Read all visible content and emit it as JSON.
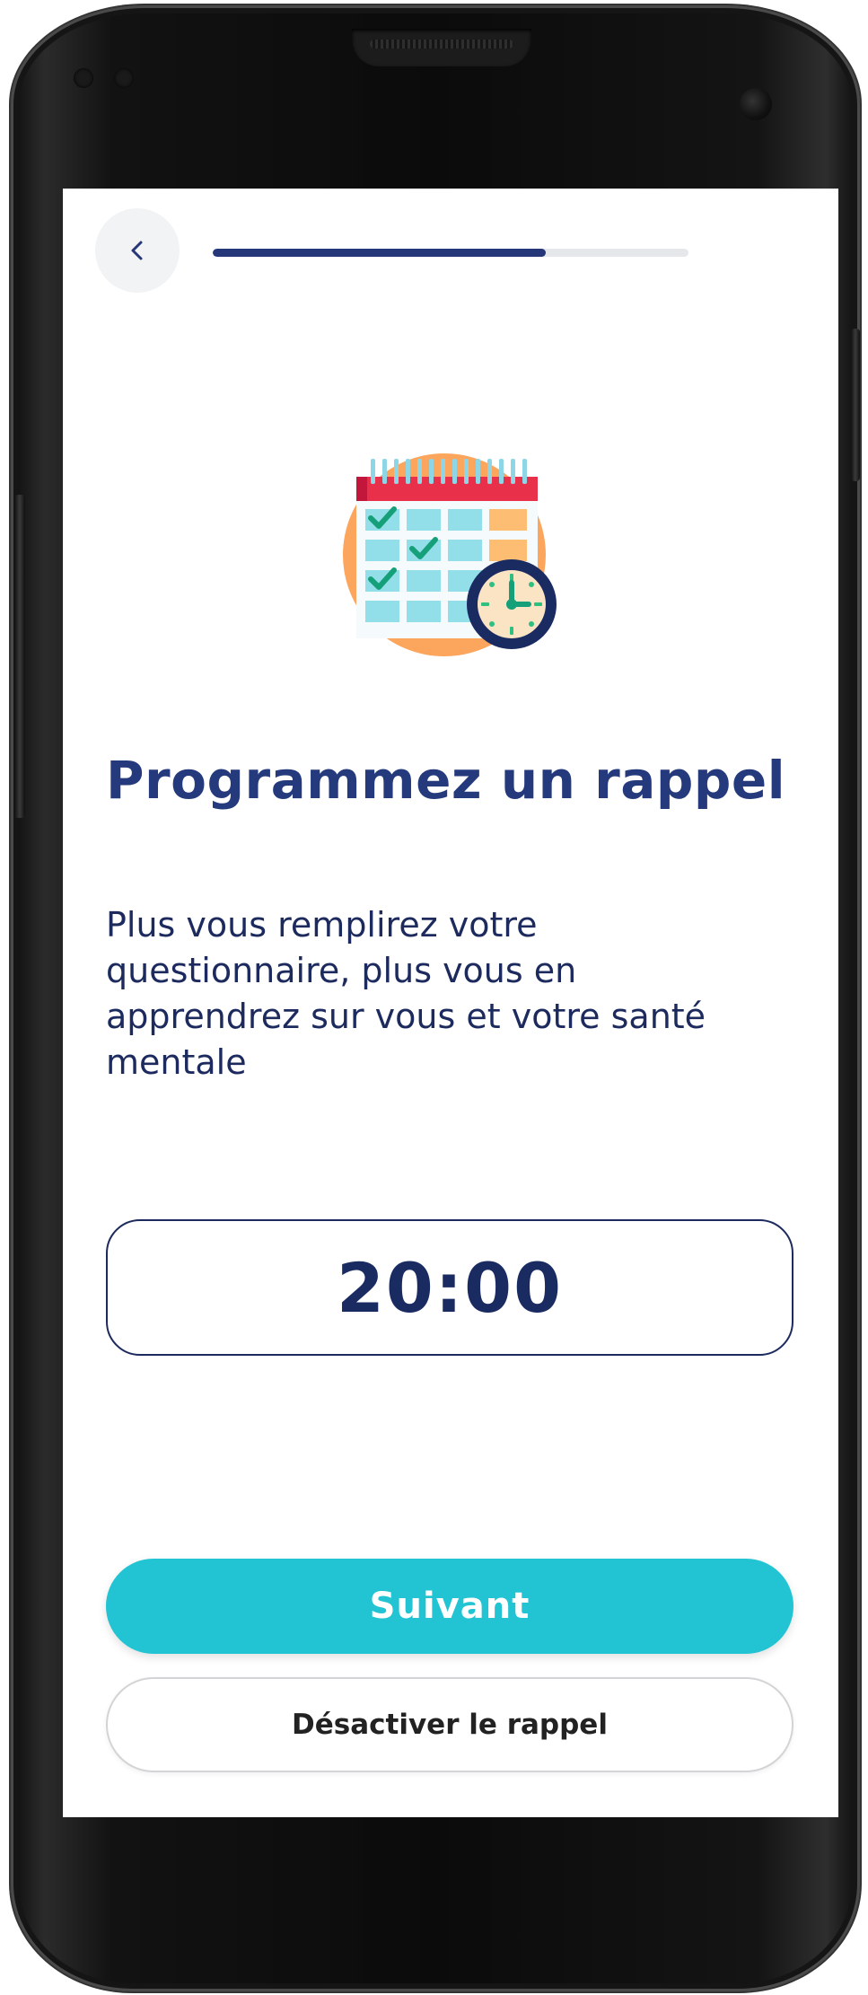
{
  "header": {
    "back_icon": "chevron-left-icon",
    "progress": 0.7
  },
  "illustration": {
    "icon": "calendar-clock-icon"
  },
  "content": {
    "title": "Programmez un rappel",
    "description": "Plus vous remplirez votre questionnaire, plus vous en apprendrez sur vous et votre santé mentale"
  },
  "reminder": {
    "time": "20:00"
  },
  "actions": {
    "next_label": "Suivant",
    "disable_label": "Désactiver le rappel"
  },
  "colors": {
    "primary": "#22c4d3",
    "navy": "#243a7c",
    "progress_fill": "#253679",
    "progress_track": "#e6e7ea"
  }
}
